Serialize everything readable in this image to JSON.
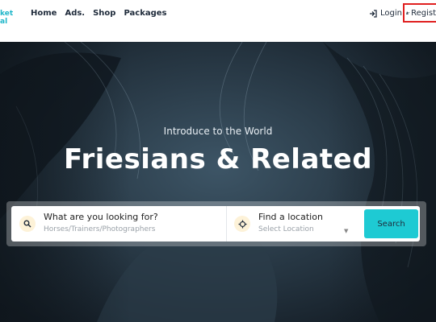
{
  "header": {
    "logo_lines": [
      "ket",
      "al"
    ],
    "nav": [
      {
        "label": "Home"
      },
      {
        "label": "Ads."
      },
      {
        "label": "Shop"
      },
      {
        "label": "Packages"
      }
    ],
    "login_label": "Login",
    "register_label": "Regist"
  },
  "hero": {
    "intro": "Introduce to the World",
    "title": "Friesians & Related"
  },
  "search": {
    "what_label": "What are you looking for?",
    "what_placeholder": "Horses/Trainers/Photographers",
    "where_label": "Find a location",
    "where_placeholder": "Select Location",
    "button_label": "Search"
  },
  "colors": {
    "accent": "#1ecad3",
    "highlight_border": "#e02020",
    "icon_bg": "#fdf2d8"
  }
}
